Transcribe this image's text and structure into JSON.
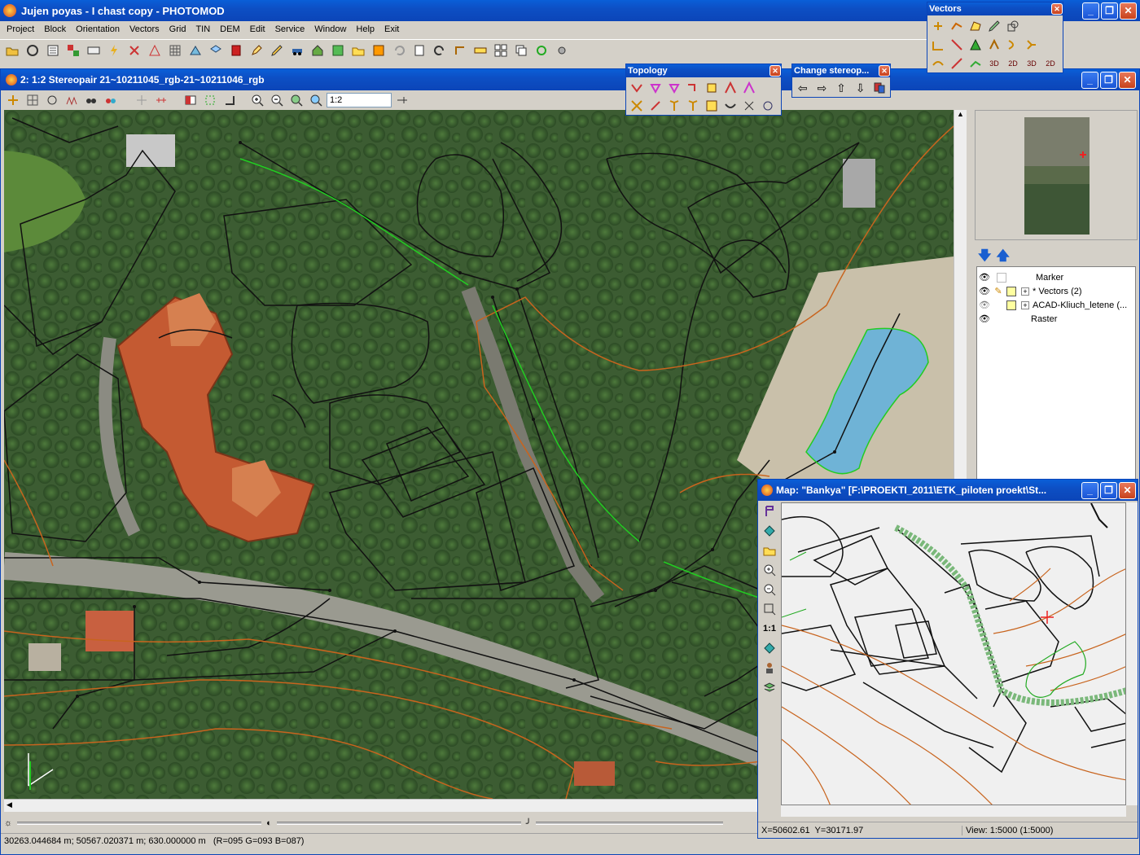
{
  "app": {
    "title": "Jujen poyas - I chast copy - PHOTOMOD",
    "menu": [
      "Project",
      "Block",
      "Orientation",
      "Vectors",
      "Grid",
      "TIN",
      "DEM",
      "Edit",
      "Service",
      "Window",
      "Help",
      "Exit"
    ]
  },
  "stereo_window": {
    "title": "2: 1:2 Stereopair 21~10211045_rgb-21~10211046_rgb",
    "zoom_value": "1:2",
    "status": "30263.044684 m; 50567.020371 m; 630.000000 m   (R=095 G=093 B=087)"
  },
  "vectors_toolbar": {
    "title": "Vectors",
    "labels_3d": [
      "3D",
      "2D",
      "3D",
      "2D"
    ]
  },
  "topology_toolbar": {
    "title": "Topology"
  },
  "stereo_toolbar": {
    "title": "Change stereop..."
  },
  "layers": {
    "items": [
      {
        "label": "Marker"
      },
      {
        "label": "* Vectors (2)"
      },
      {
        "label": "ACAD-Kliuch_letene (..."
      },
      {
        "label": "Raster"
      }
    ]
  },
  "map_window": {
    "title": "Map: \"Bankya\" [F:\\PROEKTI_2011\\ETK_piloten proekt\\St...",
    "scale_label": "1:1",
    "coords": "X=50602.61  Y=30171.97",
    "view": "View: 1:5000 (1:5000)"
  },
  "colors": {
    "caption": "#0b45b8",
    "vector_black": "#111111",
    "contour_orange": "#c8641e",
    "edit_green": "#22cc22"
  }
}
